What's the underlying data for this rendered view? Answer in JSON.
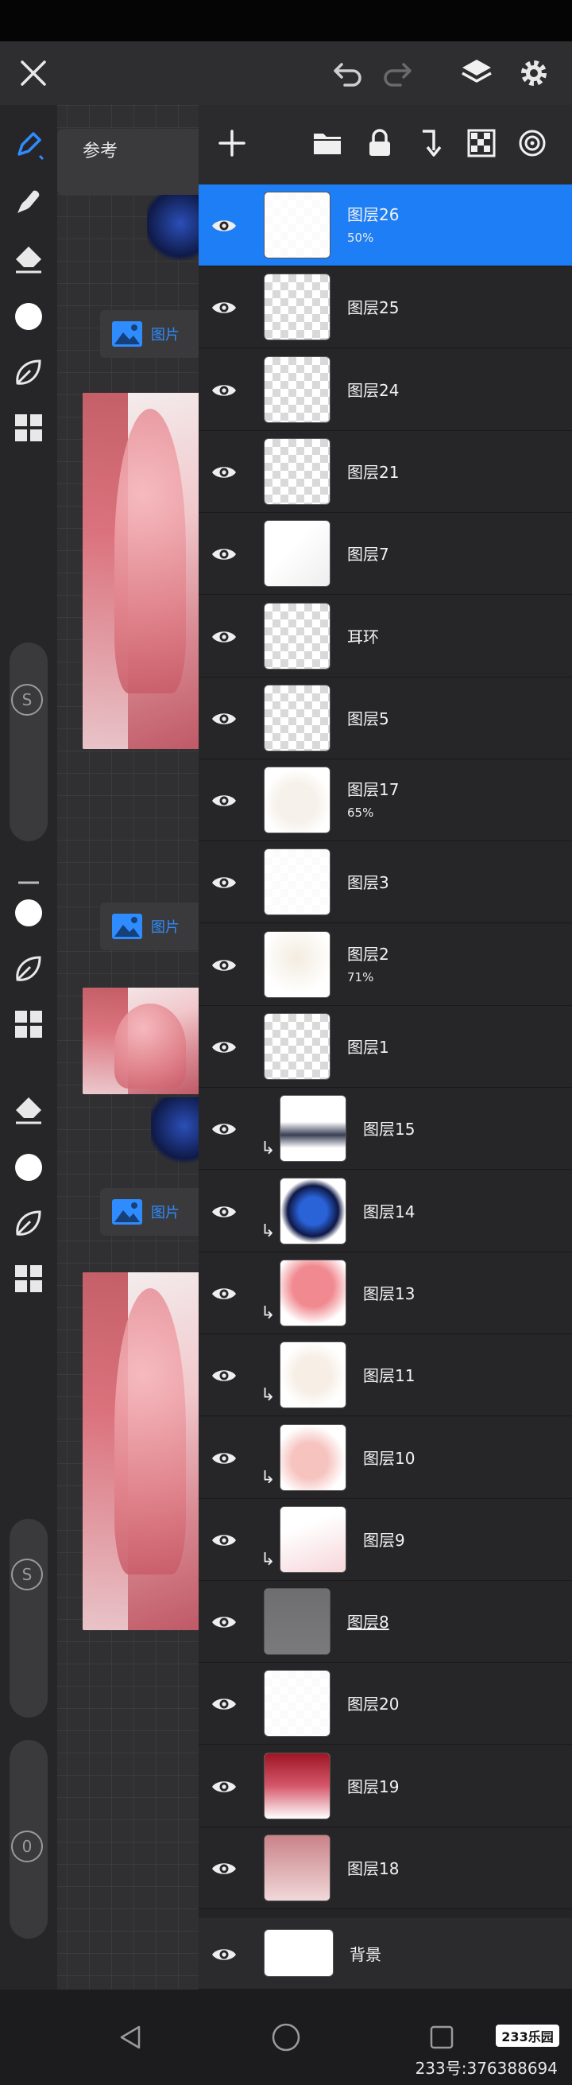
{
  "reference": {
    "title": "参考",
    "image_label": "图片"
  },
  "layers": [
    {
      "name": "图层26",
      "opacity": "50%",
      "selected": true
    },
    {
      "name": "图层25",
      "opacity": ""
    },
    {
      "name": "图层24",
      "opacity": ""
    },
    {
      "name": "图层21",
      "opacity": ""
    },
    {
      "name": "图层7",
      "opacity": ""
    },
    {
      "name": "耳环",
      "opacity": ""
    },
    {
      "name": "图层5",
      "opacity": ""
    },
    {
      "name": "图层17",
      "opacity": "65%"
    },
    {
      "name": "图层3",
      "opacity": ""
    },
    {
      "name": "图层2",
      "opacity": "71%"
    },
    {
      "name": "图层1",
      "opacity": ""
    },
    {
      "name": "图层15",
      "opacity": "",
      "clipped": true
    },
    {
      "name": "图层14",
      "opacity": "",
      "clipped": true
    },
    {
      "name": "图层13",
      "opacity": "",
      "clipped": true
    },
    {
      "name": "图层11",
      "opacity": "",
      "clipped": true
    },
    {
      "name": "图层10",
      "opacity": "",
      "clipped": true
    },
    {
      "name": "图层9",
      "opacity": "",
      "clipped": true
    },
    {
      "name": "图层8",
      "opacity": "",
      "underline": true
    },
    {
      "name": "图层20",
      "opacity": ""
    },
    {
      "name": "图层19",
      "opacity": ""
    },
    {
      "name": "图层18",
      "opacity": ""
    }
  ],
  "background_layer": {
    "name": "背景"
  },
  "watermark": {
    "brand": "233乐园",
    "text": "233号:376388694"
  },
  "colors": {
    "accent": "#1e7ef5",
    "link": "#2e8cff"
  },
  "icons": [
    "close-icon",
    "undo-icon",
    "redo-icon",
    "layers-icon",
    "settings-icon",
    "brush-icon",
    "smudge-icon",
    "eraser-icon",
    "color-icon",
    "leaf-icon",
    "grid-icon",
    "add-icon",
    "folder-icon",
    "lock-icon",
    "merge-down-icon",
    "transparency-icon",
    "target-icon",
    "eye-icon",
    "back-icon",
    "home-icon",
    "recents-icon"
  ]
}
